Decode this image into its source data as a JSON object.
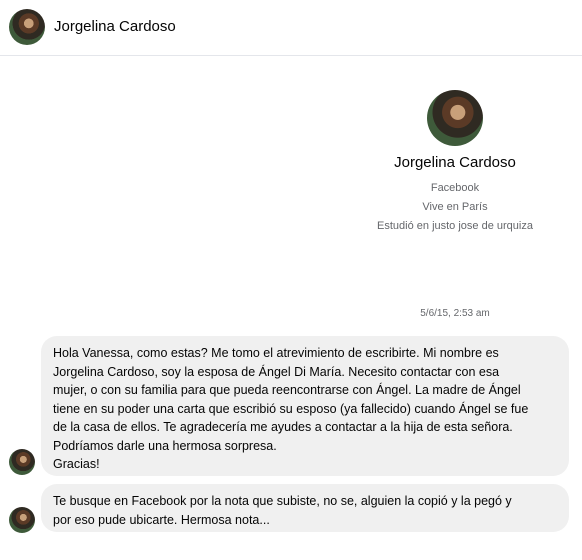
{
  "header": {
    "name": "Jorgelina Cardoso"
  },
  "profile": {
    "name": "Jorgelina Cardoso",
    "info": [
      "Facebook",
      "Vive en París",
      "Estudió en justo jose de urquiza"
    ]
  },
  "conversation": {
    "timestamp": "5/6/15, 2:53 am",
    "messages": [
      {
        "lines": [
          "Hola Vanessa, como estas? Me tomo el atrevimiento de escribirte. Mi nombre es",
          "Jorgelina Cardoso, soy la esposa de Ángel Di María. Necesito contactar con esa",
          "mujer, o con su familia para que pueda reencontrarse con Ángel. La madre de Ángel",
          "tiene en su poder una carta que escribió su esposo (ya fallecido) cuando Ángel se fue",
          "de la casa de ellos. Te agradecería me ayudes a contactar a la hija de esta señora.",
          "Podríamos darle una hermosa sorpresa.",
          "Gracias!"
        ]
      },
      {
        "lines": [
          "Te busque en Facebook por la nota que subiste, no se, alguien la copió y la pegó y",
          "por eso pude ubicarte. Hermosa nota..."
        ]
      }
    ]
  }
}
